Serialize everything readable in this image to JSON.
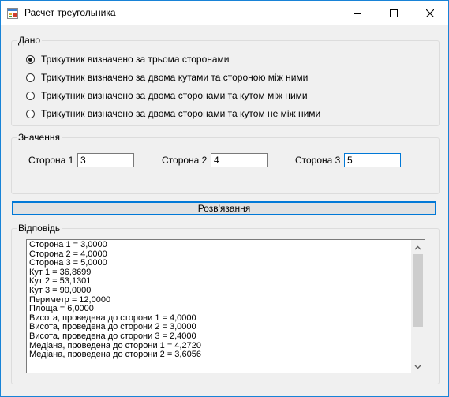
{
  "window": {
    "title": "Расчет треугольника"
  },
  "given": {
    "label": "Дано",
    "options": [
      {
        "label": "Трикутник визначено за трьома сторонами",
        "checked": true
      },
      {
        "label": "Трикутник визначено за двома кутами та стороною між ними",
        "checked": false
      },
      {
        "label": "Трикутник визначено за двома сторонами та кутом між ними",
        "checked": false
      },
      {
        "label": "Трикутник визначено за двома сторонами та кутом не між ними",
        "checked": false
      }
    ]
  },
  "values": {
    "label": "Значення",
    "fields": [
      {
        "label": "Сторона 1",
        "value": "3"
      },
      {
        "label": "Сторона 2",
        "value": "4"
      },
      {
        "label": "Сторона 3",
        "value": "5"
      }
    ]
  },
  "solve_button": {
    "label": "Розв'язання"
  },
  "answer": {
    "label": "Відповідь",
    "lines": [
      "Сторона 1 = 3,0000",
      "Сторона 2 = 4,0000",
      "Сторона 3 = 5,0000",
      "Кут 1 = 36,8699",
      "Кут 2 = 53,1301",
      "Кут 3 = 90,0000",
      "Периметр = 12,0000",
      "Площа = 6,0000",
      "Висота, проведена до сторони 1 = 4,0000",
      "Висота, проведена до сторони 2 = 3,0000",
      "Висота, проведена до сторони 3 = 2,4000",
      "Медіана, проведена до сторони 1 = 4,2720",
      "Медіана, проведена до сторони 2 = 3,6056"
    ]
  },
  "icons": {
    "app": "app-icon",
    "minimize": "minimize-icon",
    "maximize": "maximize-icon",
    "close": "close-icon",
    "scroll_up": "scroll-up-arrow-icon",
    "scroll_down": "scroll-down-arrow-icon"
  },
  "colors": {
    "accent": "#0078d7",
    "window_border": "#1883d7",
    "background": "#f0f0f0"
  }
}
